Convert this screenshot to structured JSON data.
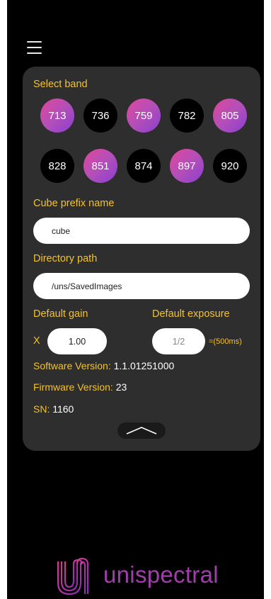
{
  "menu": {
    "icon": "hamburger-menu-icon"
  },
  "band_section": {
    "label": "Select band",
    "bands": [
      {
        "value": "713",
        "selected": true
      },
      {
        "value": "736",
        "selected": false
      },
      {
        "value": "759",
        "selected": true
      },
      {
        "value": "782",
        "selected": false
      },
      {
        "value": "805",
        "selected": true
      },
      {
        "value": "828",
        "selected": false
      },
      {
        "value": "851",
        "selected": true
      },
      {
        "value": "874",
        "selected": false
      },
      {
        "value": "897",
        "selected": true
      },
      {
        "value": "920",
        "selected": false
      }
    ]
  },
  "cube_prefix": {
    "label": "Cube prefix name",
    "value": "cube"
  },
  "directory": {
    "label": "Directory path",
    "value": "/uns/SavedImages"
  },
  "gain": {
    "label": "Default gain",
    "prefix": "X",
    "value": "1.00"
  },
  "exposure": {
    "label": "Default exposure",
    "value": "1/2",
    "suffix": "=(500ms)"
  },
  "info": {
    "software_label": "Software Version:",
    "software_value": "1.1.01251000",
    "firmware_label": "Firmware Version:",
    "firmware_value": "23",
    "sn_label": "SN:",
    "sn_value": "1160"
  },
  "collapse": {
    "icon": "chevron-up-icon"
  },
  "brand": {
    "name": "unispectral",
    "logo_icon": "unispectral-logo-icon"
  },
  "colors": {
    "accent_yellow": "#f2c230",
    "panel": "#2e2e2e",
    "background": "#000000",
    "brand_purple": "#a33dab",
    "selected_gradient_start": "#e0479a",
    "selected_gradient_end": "#8b3fcf"
  }
}
